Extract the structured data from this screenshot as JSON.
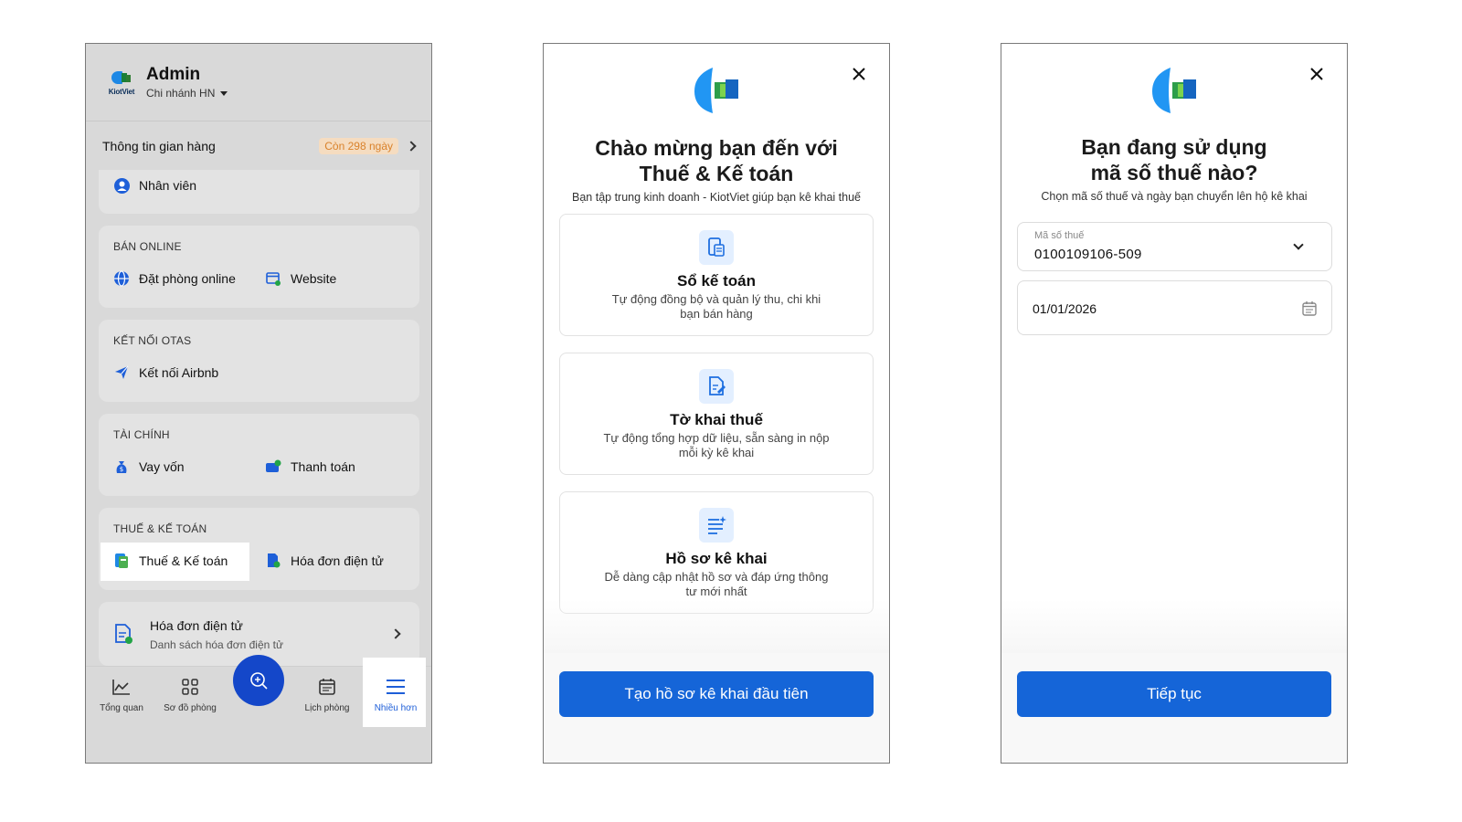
{
  "phone1": {
    "header": {
      "logo_text": "KiotViet",
      "user_name": "Admin",
      "branch": "Chi nhánh HN"
    },
    "shop_info": {
      "label": "Thông tin gian hàng",
      "badge": "Còn 298 ngày"
    },
    "staff": {
      "label": "Nhân viên"
    },
    "online": {
      "title": "BÁN ONLINE",
      "items": [
        "Đặt phòng online",
        "Website"
      ]
    },
    "otas": {
      "title": "KẾT NỐI OTAS",
      "items": [
        "Kết nối Airbnb"
      ]
    },
    "finance": {
      "title": "TÀI CHÍNH",
      "items": [
        "Vay vốn",
        "Thanh toán"
      ]
    },
    "tax": {
      "title": "THUẾ & KẾ TOÁN",
      "items": [
        "Thuế & Kế toán",
        "Hóa đơn điện tử"
      ]
    },
    "einvoice": {
      "title": "Hóa đơn điện tử",
      "subtitle": "Danh sách hóa đơn điện tử"
    },
    "tabs": [
      "Tổng quan",
      "Sơ đồ phòng",
      "Lịch phòng",
      "Nhiều hơn"
    ],
    "active_tab": "Nhiều hơn",
    "colors": {
      "accent": "#1447c9",
      "active": "#1d5ed8",
      "badge_bg": "#f5dcc0",
      "badge_text": "#d9822b"
    }
  },
  "phone2": {
    "title_line1": "Chào mừng bạn đến với",
    "title_line2": "Thuế & Kế toán",
    "subtitle": "Bạn tập trung kinh doanh - KiotViet giúp bạn kê khai thuế",
    "features": [
      {
        "title": "Sổ kế toán",
        "desc": "Tự động đồng bộ và quản lý thu, chi khi bạn bán hàng",
        "icon": "ledger-icon"
      },
      {
        "title": "Tờ khai thuế",
        "desc": "Tự động tổng hợp dữ liệu, sẵn sàng in nộp mỗi kỳ kê khai",
        "icon": "tax-form-icon"
      },
      {
        "title": "Hồ sơ kê khai",
        "desc": "Dễ dàng cập nhật hồ sơ và đáp ứng thông tư mới nhất",
        "icon": "profile-list-icon"
      }
    ],
    "cta": "Tạo hồ sơ kê khai đầu tiên"
  },
  "phone3": {
    "title_line1": "Bạn đang sử dụng",
    "title_line2": "mã số thuế nào?",
    "subtitle": "Chọn mã số thuế và ngày bạn chuyển lên hộ kê khai",
    "tax_code": {
      "label": "Mã số thuế",
      "value": "0100109106-509"
    },
    "date": {
      "value": "01/01/2026"
    },
    "cta": "Tiếp tục"
  }
}
